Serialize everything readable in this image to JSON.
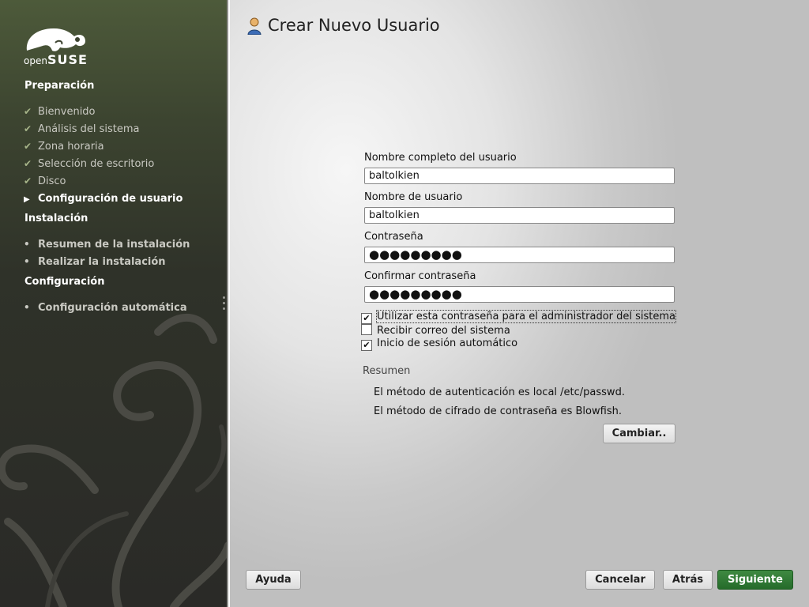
{
  "sidebar": {
    "logo": {
      "open": "open",
      "suse": "SUSE"
    },
    "sections": [
      {
        "title": "Preparación",
        "steps": [
          {
            "label": "Bienvenido",
            "state": "done"
          },
          {
            "label": "Análisis del sistema",
            "state": "done"
          },
          {
            "label": "Zona horaria",
            "state": "done"
          },
          {
            "label": "Selección de escritorio",
            "state": "done"
          },
          {
            "label": "Disco",
            "state": "done"
          },
          {
            "label": "Configuración de usuario",
            "state": "current"
          }
        ]
      },
      {
        "title": "Instalación",
        "steps": [
          {
            "label": "Resumen de la instalación",
            "state": "todo"
          },
          {
            "label": "Realizar la instalación",
            "state": "todo"
          }
        ]
      },
      {
        "title": "Configuración",
        "steps": [
          {
            "label": "Configuración automática",
            "state": "todo"
          }
        ]
      }
    ],
    "markers": {
      "done": "✔",
      "current": "▶",
      "todo": "•"
    }
  },
  "main": {
    "title": "Crear Nuevo Usuario",
    "form": {
      "full_name_label": "Nombre completo del usuario",
      "full_name_value": "baltolkien",
      "username_label": "Nombre de usuario",
      "username_value": "baltolkien",
      "password_label": "Contraseña",
      "password_dots": "●●●●●●●●●",
      "confirm_label": "Confirmar contraseña",
      "confirm_dots": "●●●●●●●●●"
    },
    "checkboxes": [
      {
        "label": "Utilizar esta contraseña para el administrador del sistema",
        "checked": true
      },
      {
        "label": "Recibir correo del sistema",
        "checked": false
      },
      {
        "label": "Inicio de sesión automático",
        "checked": true
      }
    ],
    "summary": {
      "title": "Resumen",
      "lines": [
        "El método de autenticación es local /etc/passwd.",
        "El método de cifrado de contraseña es Blowfish."
      ],
      "change_button": "Cambiar.."
    }
  },
  "footer": {
    "help": "Ayuda",
    "cancel": "Cancelar",
    "back": "Atrás",
    "next": "Siguiente"
  },
  "colors": {
    "accent_green": "#2f7a34",
    "sidebar_dark": "#2a2a27"
  }
}
